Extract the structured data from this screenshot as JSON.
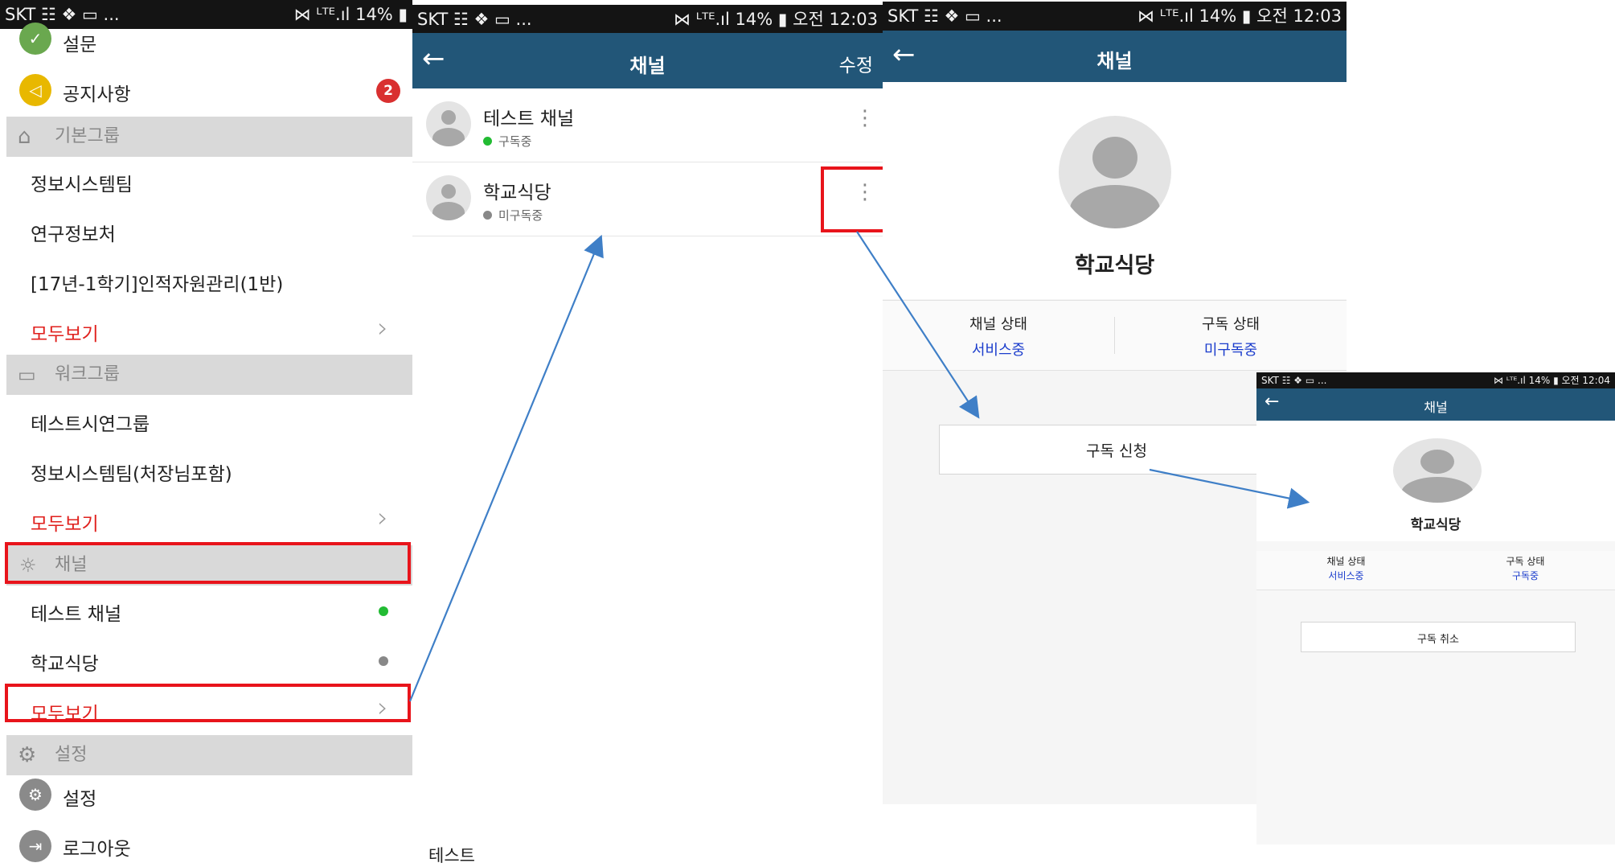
{
  "status": {
    "carrier": "SKT",
    "left_icons": "☷ ❖ ▭ ...",
    "right_icons": "⋈ ᴸᵀᴱ.ıl",
    "battery": "14%",
    "time": "오전 12:03",
    "time_small": "오전 12:04"
  },
  "menu": {
    "items_top": [
      {
        "label": "설문",
        "icon": "survey-icon",
        "color": "#6aa84f"
      },
      {
        "label": "공지사항",
        "icon": "megaphone-icon",
        "color": "#e8b800",
        "badge": "2"
      }
    ],
    "section_basic": "기본그룹",
    "basic_groups": [
      "정보시스템팀",
      "연구정보처",
      "[17년-1학기]인적자원관리(1반)"
    ],
    "see_all_1": "모두보기",
    "section_work": "워크그룹",
    "work_groups": [
      "테스트시연그룹",
      "정보시스템팀(처장님포함)"
    ],
    "see_all_2": "모두보기",
    "section_channel": "채널",
    "channels": [
      {
        "label": "테스트 채널",
        "dot_color": "#22bb33"
      },
      {
        "label": "학교식당",
        "dot_color": "#888888"
      }
    ],
    "see_all_3": "모두보기",
    "section_settings": "설정",
    "settings_item": "설정",
    "logout_item": "로그아웃"
  },
  "channel_list": {
    "title": "채널",
    "edit": "수정",
    "items": [
      {
        "name": "테스트 채널",
        "status": "구독중",
        "status_color": "#22bb33"
      },
      {
        "name": "학교식당",
        "status": "미구독중",
        "status_color": "#888888"
      }
    ],
    "bottom_label": "테스트"
  },
  "channel_detail": {
    "title": "채널",
    "name": "학교식당",
    "channel_status_label": "채널 상태",
    "channel_status_value": "서비스중",
    "sub_status_label": "구독 상태",
    "sub_status_value": "미구독중",
    "button": "구독 신청"
  },
  "channel_detail2": {
    "title": "채널",
    "name": "학교식당",
    "channel_status_label": "채널 상태",
    "channel_status_value": "서비스중",
    "sub_status_label": "구독 상태",
    "sub_status_value": "구독중",
    "button": "구독 취소"
  },
  "colors": {
    "header": "#225678",
    "accent_red": "#e8141b",
    "link_blue": "#1a3ccc",
    "arrow": "#3f7fc7"
  }
}
